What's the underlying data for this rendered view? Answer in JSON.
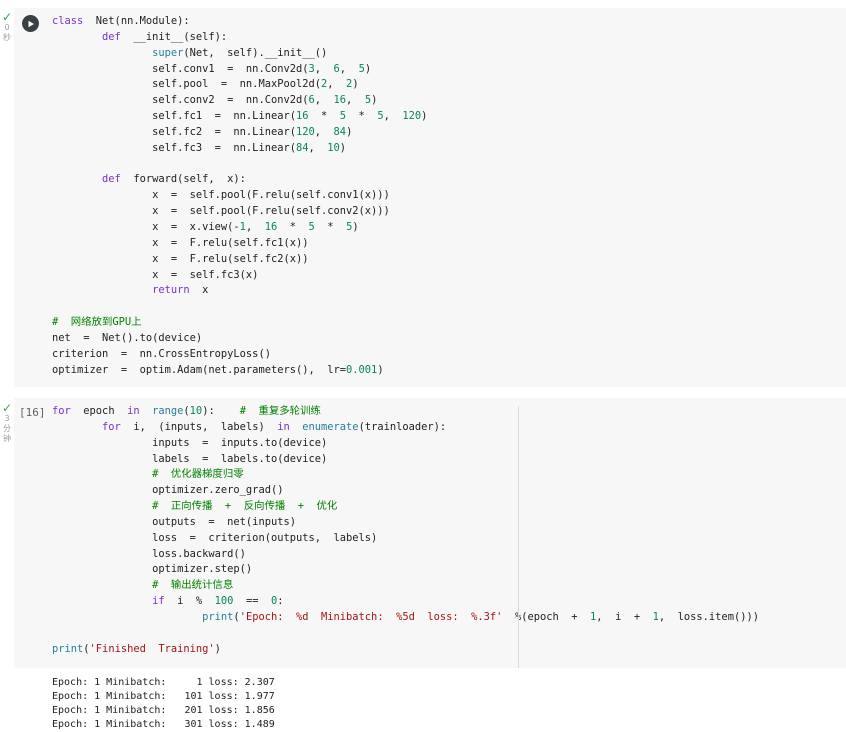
{
  "cell1": {
    "gutter_time": [
      "0",
      "秒"
    ],
    "lines": [
      "class  Net(nn.Module):",
      "        def  __init__(self):",
      "                super(Net,  self).__init__()",
      "                self.conv1  =  nn.Conv2d(3,  6,  5)",
      "                self.pool  =  nn.MaxPool2d(2,  2)",
      "                self.conv2  =  nn.Conv2d(6,  16,  5)",
      "                self.fc1  =  nn.Linear(16  *  5  *  5,  120)",
      "                self.fc2  =  nn.Linear(120,  84)",
      "                self.fc3  =  nn.Linear(84,  10)",
      "",
      "        def  forward(self,  x):",
      "                x  =  self.pool(F.relu(self.conv1(x)))",
      "                x  =  self.pool(F.relu(self.conv2(x)))",
      "                x  =  x.view(-1,  16  *  5  *  5)",
      "                x  =  F.relu(self.fc1(x))",
      "                x  =  F.relu(self.fc2(x))",
      "                x  =  self.fc3(x)",
      "                return  x",
      "",
      "#  网络放到GPU上",
      "net  =  Net().to(device)",
      "criterion  =  nn.CrossEntropyLoss()",
      "optimizer  =  optim.Adam(net.parameters(),  lr=0.001)"
    ]
  },
  "cell2": {
    "exec_count": "[16]",
    "gutter_time": [
      "3",
      "分",
      "钟"
    ],
    "lines": [
      "for  epoch  in  range(10):    #  重复多轮训练",
      "        for  i,  (inputs,  labels)  in  enumerate(trainloader):",
      "                inputs  =  inputs.to(device)",
      "                labels  =  labels.to(device)",
      "                #  优化器梯度归零",
      "                optimizer.zero_grad()",
      "                #  正向传播  +  反向传播  +  优化",
      "                outputs  =  net(inputs)",
      "                loss  =  criterion(outputs,  labels)",
      "                loss.backward()",
      "                optimizer.step()",
      "                #  输出统计信息",
      "                if  i  %  100  ==  0:",
      "                        print('Epoch:  %d  Minibatch:  %5d  loss:  %.3f'  %(epoch  +  1,  i  +  1,  loss.item()))",
      "",
      "print('Finished  Training')"
    ]
  },
  "output_lines": [
    "Epoch: 1 Minibatch:     1 loss: 2.307",
    "Epoch: 1 Minibatch:   101 loss: 1.977",
    "Epoch: 1 Minibatch:   201 loss: 1.856",
    "Epoch: 1 Minibatch:   301 loss: 1.489"
  ],
  "colors": {
    "keyword": "#7b30d0",
    "comment": "#008000",
    "number": "#098658",
    "string": "#a31515",
    "check": "#34a853"
  },
  "icons": {
    "run": "play-icon",
    "status": "check-icon"
  }
}
